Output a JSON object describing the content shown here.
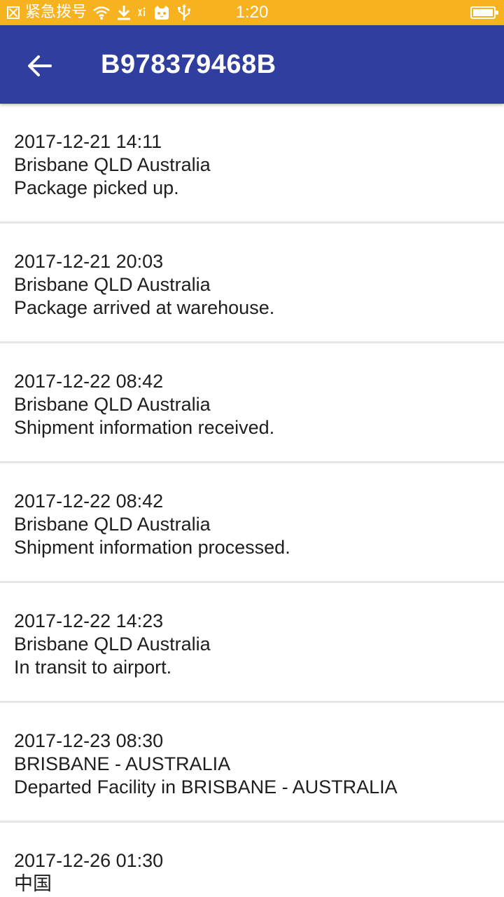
{
  "status_bar": {
    "carrier_text": "紧急拨号",
    "time": "1:20",
    "icons": [
      "sim-off-icon",
      "wifi-icon",
      "download-icon",
      "signal-icon",
      "android-cat-icon",
      "usb-icon",
      "battery-icon"
    ],
    "background": "#f7b21f"
  },
  "app_bar": {
    "title": "B978379468B",
    "back_icon": "arrow-left-icon",
    "background": "#303f9f"
  },
  "events": [
    {
      "datetime": "2017-12-21 14:11",
      "location": "Brisbane QLD Australia",
      "description": "Package picked up."
    },
    {
      "datetime": "2017-12-21 20:03",
      "location": "Brisbane QLD Australia",
      "description": "Package arrived at warehouse."
    },
    {
      "datetime": "2017-12-22 08:42",
      "location": "Brisbane QLD Australia",
      "description": "Shipment information received."
    },
    {
      "datetime": "2017-12-22 08:42",
      "location": "Brisbane QLD Australia",
      "description": "Shipment information processed."
    },
    {
      "datetime": "2017-12-22 14:23",
      "location": "Brisbane QLD Australia",
      "description": "In transit to airport."
    },
    {
      "datetime": "2017-12-23 08:30",
      "location": "BRISBANE - AUSTRALIA",
      "description": "Departed Facility in BRISBANE - AUSTRALIA"
    },
    {
      "datetime": "2017-12-26 01:30",
      "location": "中国",
      "description": ""
    }
  ]
}
